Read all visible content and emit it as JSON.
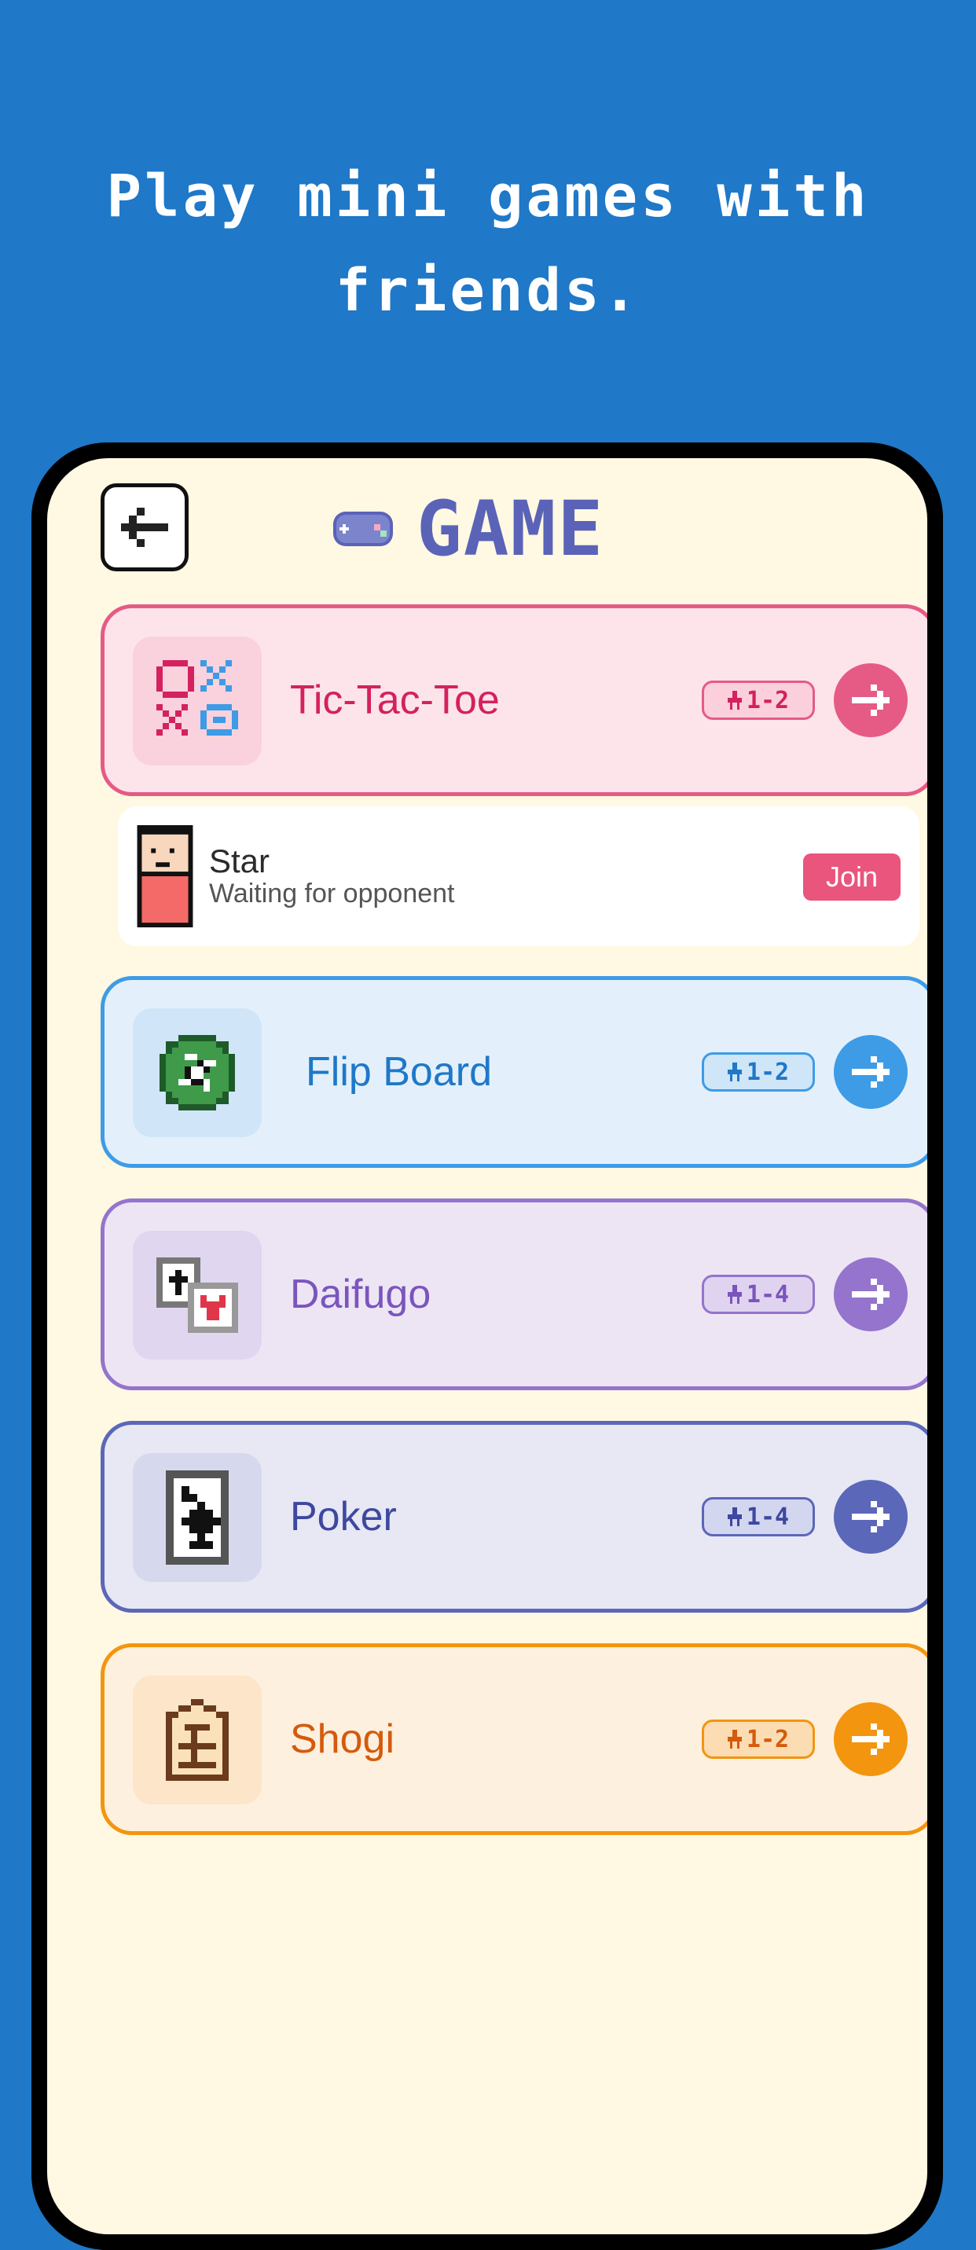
{
  "headline": "Play mini games with friends.",
  "header": {
    "title": "GAME",
    "back_icon": "arrow-left-icon",
    "controller_icon": "gamepad-icon"
  },
  "games": [
    {
      "name": "Tic-Tac-Toe",
      "players": "1-2",
      "icon": "tic-tac-toe-icon",
      "accent": "#e55b85",
      "bg": "#fde4ea",
      "icon_bg": "#f9d2dd",
      "text": "#d4215f"
    },
    {
      "name": "Flip Board",
      "players": "1-2",
      "icon": "othello-disc-icon",
      "accent": "#3e9be6",
      "bg": "#e3f0fb",
      "icon_bg": "#d0e6f8",
      "text": "#1f78c8"
    },
    {
      "name": "Daifugo",
      "players": "1-4",
      "icon": "playing-cards-icon",
      "accent": "#9474cc",
      "bg": "#ede5f4",
      "icon_bg": "#e1d6ef",
      "text": "#7a55bd"
    },
    {
      "name": "Poker",
      "players": "1-4",
      "icon": "spade-card-icon",
      "accent": "#5b67b8",
      "bg": "#e7e8f4",
      "icon_bg": "#d6d9ee",
      "text": "#3e48a0"
    },
    {
      "name": "Shogi",
      "players": "1-2",
      "icon": "shogi-piece-icon",
      "accent": "#f3950f",
      "bg": "#fdf0df",
      "icon_bg": "#fde5c9",
      "text": "#d55a0c"
    }
  ],
  "waiting_room": {
    "player_name": "Star",
    "status": "Waiting for opponent",
    "join_label": "Join"
  }
}
